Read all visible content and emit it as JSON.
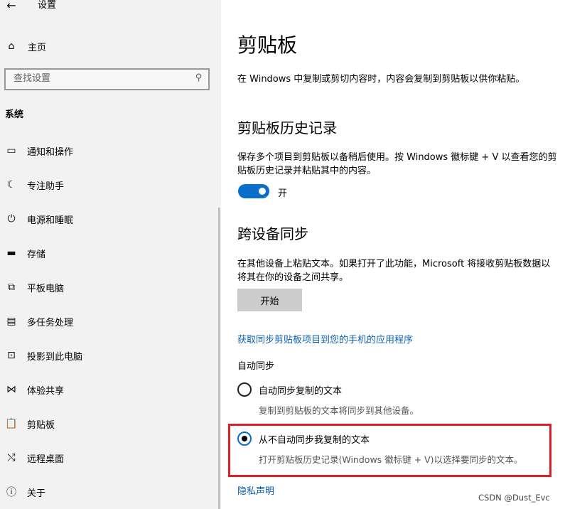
{
  "window": {
    "back_glyph": "←",
    "title": "设置"
  },
  "sidebar": {
    "home_icon": "home-icon",
    "home_label": "主页",
    "search_placeholder": "查找设置",
    "section_title": "系统",
    "items": [
      {
        "label": "通知和操作",
        "icon": "notification-icon"
      },
      {
        "label": "专注助手",
        "icon": "moon-icon"
      },
      {
        "label": "电源和睡眠",
        "icon": "power-icon"
      },
      {
        "label": "存储",
        "icon": "storage-icon"
      },
      {
        "label": "平板电脑",
        "icon": "tablet-icon"
      },
      {
        "label": "多任务处理",
        "icon": "multitask-icon"
      },
      {
        "label": "投影到此电脑",
        "icon": "project-icon"
      },
      {
        "label": "体验共享",
        "icon": "share-icon"
      },
      {
        "label": "剪贴板",
        "icon": "clipboard-icon"
      },
      {
        "label": "远程桌面",
        "icon": "remote-icon"
      },
      {
        "label": "关于",
        "icon": "info-icon"
      }
    ]
  },
  "main": {
    "title": "剪贴板",
    "intro": "在 Windows 中复制或剪切内容时，内容会复制到剪贴板以供你粘贴。",
    "history": {
      "title": "剪贴板历史记录",
      "desc": "保存多个项目到剪贴板以备稍后使用。按 Windows 徽标键 + V 以查看您的剪贴板历史记录并粘贴其中的内容。",
      "toggle_state": "开",
      "toggle_on": true
    },
    "sync": {
      "title": "跨设备同步",
      "desc": "在其他设备上粘贴文本。如果打开了此功能，Microsoft 将接收剪贴板数据以将其在你的设备之间共享。",
      "start_button": "开始",
      "phone_link": "获取同步剪贴板项目到您的手机的应用程序",
      "auto_sync_label": "自动同步",
      "options": [
        {
          "label": "自动同步复制的文本",
          "desc": "复制到剪贴板的文本将同步到其他设备。",
          "selected": false
        },
        {
          "label": "从不自动同步我复制的文本",
          "desc": "打开剪贴板历史记录(Windows 徽标键 + V)以选择要同步的文本。",
          "selected": true
        }
      ]
    },
    "privacy_link": "隐私声明"
  },
  "watermark": "CSDN @Dust_Evc",
  "colors": {
    "accent": "#0a6ecb",
    "link": "#0b5fb5",
    "highlight": "#e01e24",
    "sidebar_bg": "#f2f2f2"
  }
}
